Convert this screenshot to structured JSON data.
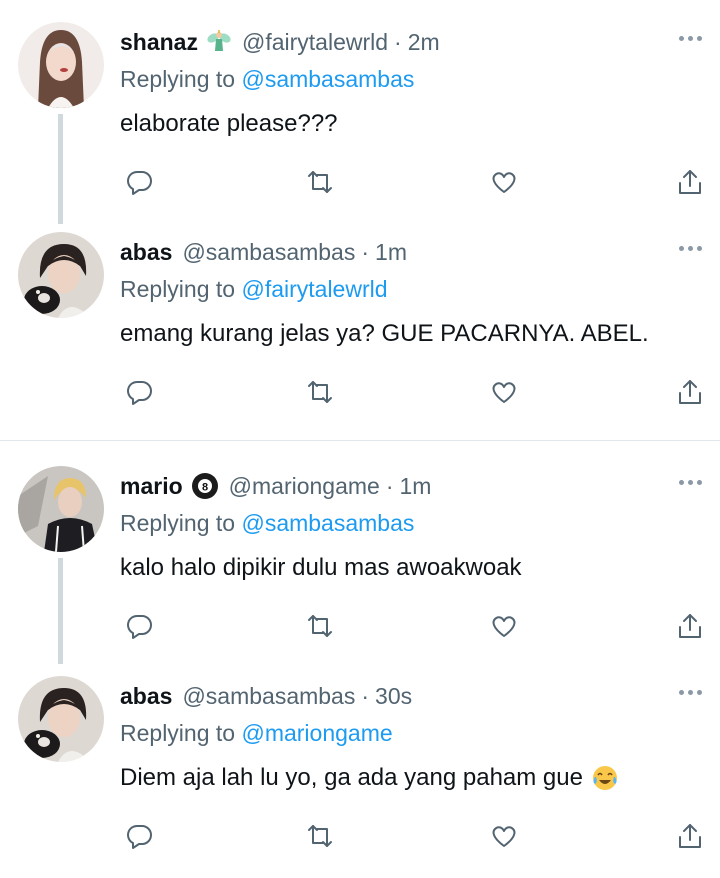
{
  "thread1": [
    {
      "name": "shanaz",
      "emoji_icon": "fairy-icon",
      "handle": "@fairytalewrld",
      "time": "2m",
      "replying_prefix": "Replying to",
      "replying_to": "@sambasambas",
      "text": "elaborate please???"
    },
    {
      "name": "abas",
      "handle": "@sambasambas",
      "time": "1m",
      "replying_prefix": "Replying to",
      "replying_to": "@fairytalewrld",
      "text": "emang kurang jelas ya? GUE PACARNYA. ABEL."
    }
  ],
  "thread2": [
    {
      "name": "mario",
      "emoji_icon": "eight-ball-icon",
      "handle": "@mariongame",
      "time": "1m",
      "replying_prefix": "Replying to",
      "replying_to": "@sambasambas",
      "text": "kalo halo dipikir dulu mas awoakwoak"
    },
    {
      "name": "abas",
      "handle": "@sambasambas",
      "time": "30s",
      "replying_prefix": "Replying to",
      "replying_to": "@mariongame",
      "text": "Diem aja lah lu yo, ga ada yang paham gue",
      "trailing_emoji_icon": "tears-of-joy-icon"
    }
  ],
  "separator": "·",
  "colors": {
    "mention": "#1d9bf0",
    "secondary": "#536471",
    "thread_line": "#cfd9de"
  }
}
